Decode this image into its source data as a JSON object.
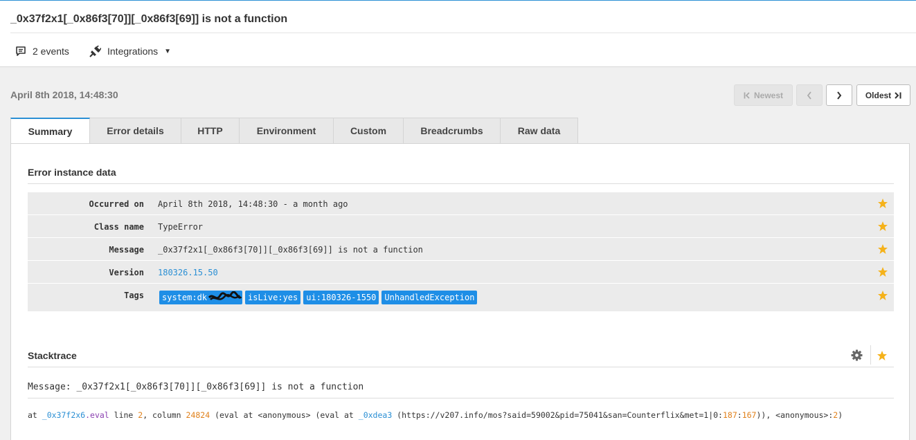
{
  "header": {
    "title": "_0x37f2x1[_0x86f3[70]][_0x86f3[69]] is not a function",
    "events_label": "2 events",
    "integrations_label": "Integrations"
  },
  "instance": {
    "date": "April 8th 2018, 14:48:30",
    "nav": {
      "newest": "Newest",
      "oldest": "Oldest"
    }
  },
  "tabs": [
    "Summary",
    "Error details",
    "HTTP",
    "Environment",
    "Custom",
    "Breadcrumbs",
    "Raw data"
  ],
  "summary": {
    "section_title": "Error instance data",
    "rows": [
      {
        "key": "Occurred on",
        "value": "April 8th 2018, 14:48:30 - a month ago"
      },
      {
        "key": "Class name",
        "value": "TypeError"
      },
      {
        "key": "Message",
        "value": "_0x37f2x1[_0x86f3[70]][_0x86f3[69]] is not a function"
      },
      {
        "key": "Version",
        "value": "180326.15.50"
      },
      {
        "key": "Tags",
        "value": ""
      }
    ],
    "tags": [
      "system:dk",
      "isLive:yes",
      "ui:180326-1550",
      "UnhandledException"
    ]
  },
  "stacktrace": {
    "title": "Stacktrace",
    "message": "Message: _0x37f2x1[_0x86f3[70]][_0x86f3[69]] is not a function",
    "frame": {
      "at": "at ",
      "fn": "_0x37f2x6",
      "method": ".eval",
      "line_label": " line ",
      "line": "2",
      "col_label": ", column ",
      "column": "24824",
      "mid1": " (eval at <anonymous> (eval at ",
      "fn2": "_0xdea3",
      "url": " (https://v207.info/mos?said=59002&pid=75041&san=Counterflix&met=1|0:",
      "n1": "187",
      "colon": ":",
      "n2": "167",
      "mid2": ")), <anonymous>:",
      "n3": "2",
      "end": ")"
    }
  },
  "colors": {
    "accent": "#2a8fd4",
    "star": "#f5b21b",
    "tag_bg": "#1e8ee6",
    "number": "#e0801a"
  }
}
